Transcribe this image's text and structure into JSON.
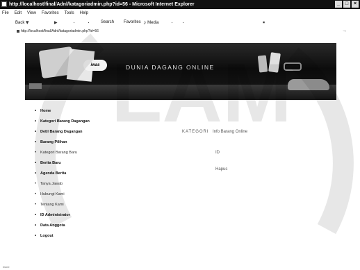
{
  "window": {
    "title": "http://localhost/final/Adnl/katagoriadmin.php?id=56 - Microsoft Internet Explorer"
  },
  "menu": [
    "File",
    "Edit",
    "View",
    "Favorites",
    "Tools",
    "Help"
  ],
  "toolbar": {
    "back_label": "Back",
    "search_label": "Search",
    "favorites_label": "Favorites",
    "media_label": "Media"
  },
  "address": {
    "url": "http://localhost/final/Adnl/katagoriadmin.php?id=56"
  },
  "banner": {
    "logo_text": "iwas",
    "headline": "DUNIA DAGANG ONLINE"
  },
  "nav": {
    "items": [
      "Home",
      "Kategori Barang Dagangan",
      "Detil Barang Dagangan",
      "Barang Pilihan",
      "Kategori Barang Baru",
      "Berita Baru",
      "Agenda Berita",
      "Tanya Jawab",
      "Hubungi Kami",
      "Tentang Kami",
      "ID Administrator",
      "Data Anggota",
      "Logout"
    ]
  },
  "content": {
    "field_label": "KATEGORI",
    "field_value": "Info Barang Online",
    "field_small": "ID",
    "field_bottom": "Hapus"
  },
  "status": {
    "text": "Done"
  },
  "colors": {
    "titlebar": "#111111",
    "banner_dark": "#0c0c0c",
    "page_bg": "#ffffff"
  }
}
